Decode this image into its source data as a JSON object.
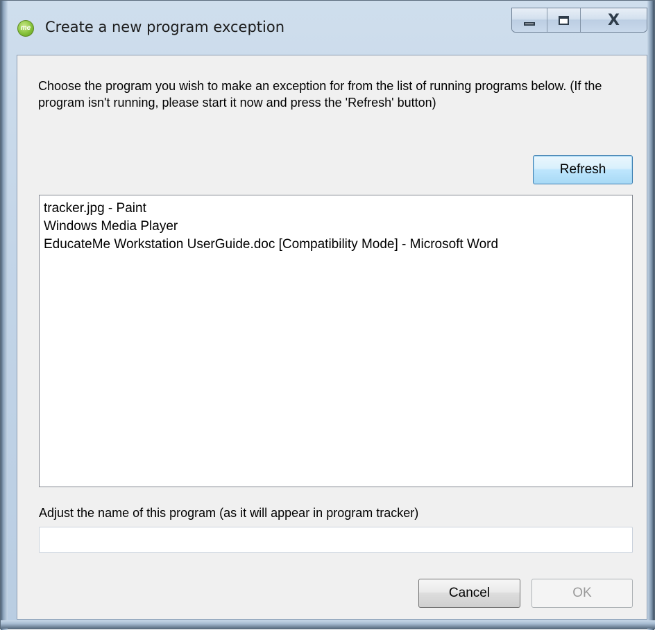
{
  "window": {
    "title": "Create a new program exception",
    "app_icon_text": "me",
    "caption_buttons": {
      "minimize_icon": "minimize-icon",
      "maximize_icon": "maximize-icon",
      "close_icon": "close-icon",
      "close_glyph": "X"
    }
  },
  "dialog": {
    "instructions": "Choose the program you wish to make an exception for from the list of running programs below. (If the program isn't running, please start it now and press the 'Refresh' button)",
    "refresh_label": "Refresh",
    "programs": [
      "tracker.jpg - Paint",
      "Windows Media Player",
      "EducateMe Workstation UserGuide.doc [Compatibility Mode] - Microsoft Word"
    ],
    "name_label": "Adjust the name of this program (as it will appear in program tracker)",
    "name_value": "",
    "name_placeholder": "",
    "cancel_label": "Cancel",
    "ok_label": "OK",
    "ok_enabled": false
  },
  "colors": {
    "frame": "#c3d5e8",
    "client_bg": "#f0f0f0",
    "accent_button_border": "#3c7fb1",
    "disabled_text": "#9a9a9a"
  }
}
